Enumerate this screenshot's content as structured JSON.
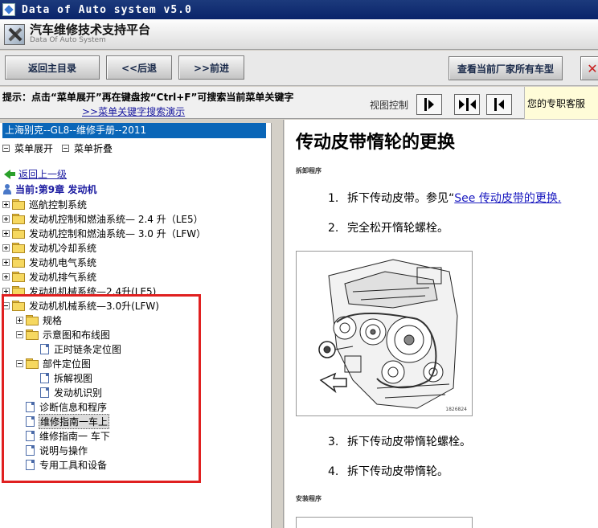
{
  "window": {
    "title": "Data of Auto system v5.0"
  },
  "brand": {
    "main": "汽车维修技术支持平台",
    "sub": "Data Of Auto System"
  },
  "toolbar": {
    "home": "返回主目录",
    "back": "<<后退",
    "forward": ">>前进",
    "all_models": "查看当前厂家所有车型",
    "close": "✕"
  },
  "hint": {
    "text": "提示：点击“菜单展开”再在键盘按“Ctrl+F”可搜索当前菜单关键字",
    "link": ">>菜单关键字搜索演示",
    "view_label": "视图控制",
    "service": "您的专职客服"
  },
  "left": {
    "manual_title": "上海别克--GL8--维修手册--2011",
    "expand": "菜单展开",
    "collapse": "菜单折叠",
    "back_link": "返回上一级",
    "current": "当前:第9章 发动机",
    "tree": [
      {
        "label": "巡航控制系统",
        "type": "folder",
        "expander": "plus"
      },
      {
        "label": "发动机控制和燃油系统— 2.4 升（LE5）",
        "type": "folder",
        "expander": "plus"
      },
      {
        "label": "发动机控制和燃油系统— 3.0 升（LFW）",
        "type": "folder",
        "expander": "plus"
      },
      {
        "label": "发动机冷却系统",
        "type": "folder",
        "expander": "plus"
      },
      {
        "label": "发动机电气系统",
        "type": "folder",
        "expander": "plus"
      },
      {
        "label": "发动机排气系统",
        "type": "folder",
        "expander": "plus"
      },
      {
        "label": "发动机机械系统—2.4升(LE5)",
        "type": "folder",
        "expander": "plus"
      },
      {
        "label": "发动机机械系统—3.0升(LFW)",
        "type": "folder",
        "expander": "minus"
      },
      {
        "label": "规格",
        "type": "folder",
        "expander": "plus"
      },
      {
        "label": "示意图和布线图",
        "type": "folder",
        "expander": "minus"
      },
      {
        "label": "正时链条定位图",
        "type": "doc",
        "expander": ""
      },
      {
        "label": "部件定位图",
        "type": "folder",
        "expander": "minus"
      },
      {
        "label": "拆解视图",
        "type": "doc",
        "expander": ""
      },
      {
        "label": "发动机识别",
        "type": "doc",
        "expander": ""
      },
      {
        "label": "诊断信息和程序",
        "type": "doc",
        "expander": ""
      },
      {
        "label": "维修指南一车上",
        "type": "doc",
        "expander": "",
        "selected": true
      },
      {
        "label": "维修指南一 车下",
        "type": "doc",
        "expander": ""
      },
      {
        "label": "说明与操作",
        "type": "doc",
        "expander": ""
      },
      {
        "label": "专用工具和设备",
        "type": "doc",
        "expander": ""
      }
    ]
  },
  "content": {
    "title": "传动皮带惰轮的更换",
    "section_remove": "拆卸程序",
    "step1_num": "1.",
    "step1_text": "拆下传动皮带。参见“",
    "step1_link": "See 传动皮带的更换.",
    "step2_num": "2.",
    "step2_text": "完全松开惰轮螺栓。",
    "figure_caption": "1826824",
    "step3_num": "3.",
    "step3_text": "拆下传动皮带惰轮螺栓。",
    "step4_num": "4.",
    "step4_text": "拆下传动皮带惰轮。",
    "section_install": "安装程序"
  }
}
